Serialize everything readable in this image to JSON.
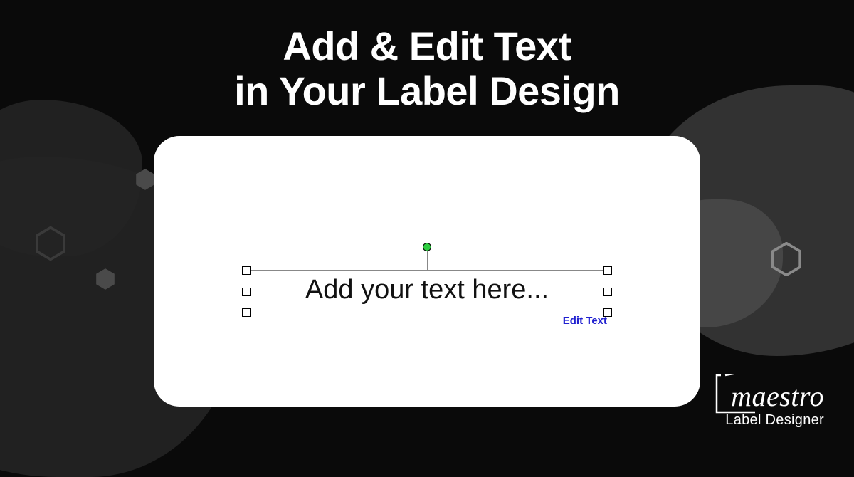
{
  "heading": {
    "line1": "Add & Edit Text",
    "line2": "in Your Label Design"
  },
  "canvas": {
    "placeholder": "Add your text here...",
    "edit_link": "Edit Text"
  },
  "logo": {
    "main": "maestro",
    "sub": "Label Designer"
  }
}
